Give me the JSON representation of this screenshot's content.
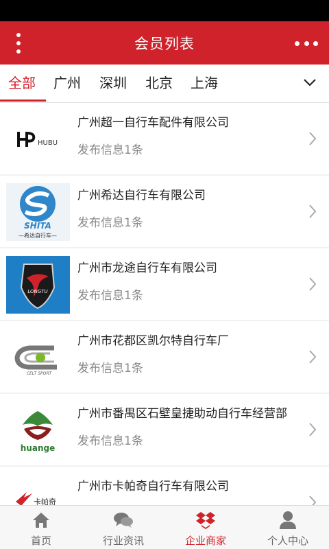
{
  "header": {
    "title": "会员列表"
  },
  "tabs": [
    {
      "label": "全部",
      "active": true
    },
    {
      "label": "广州",
      "active": false
    },
    {
      "label": "深圳",
      "active": false
    },
    {
      "label": "北京",
      "active": false
    },
    {
      "label": "上海",
      "active": false
    }
  ],
  "companies": [
    {
      "name": "广州超一自行车配件有限公司",
      "info": "发布信息1条",
      "logo_text": "HUBU"
    },
    {
      "name": "广州希达自行车有限公司",
      "info": "发布信息1条",
      "logo_text": "SHITA",
      "logo_sub": "—希达自行车—"
    },
    {
      "name": "广州市龙途自行车有限公司",
      "info": "发布信息1条",
      "logo_text": "LONGTU"
    },
    {
      "name": "广州市花都区凯尔特自行车厂",
      "info": "发布信息1条",
      "logo_text": "CELT SPORT"
    },
    {
      "name": "广州市番禺区石壁皇捷助动自行车经营部",
      "info": "发布信息1条",
      "logo_text": "huange"
    },
    {
      "name": "广州市卡帕奇自行车有限公司",
      "info": "",
      "logo_text": "卡帕奇"
    }
  ],
  "bottom_nav": [
    {
      "label": "首页",
      "icon": "home-icon",
      "active": false
    },
    {
      "label": "行业资讯",
      "icon": "chat-bubbles-icon",
      "active": false
    },
    {
      "label": "企业商家",
      "icon": "dropbox-icon",
      "active": true
    },
    {
      "label": "个人中心",
      "icon": "person-icon",
      "active": false
    }
  ],
  "colors": {
    "brand": "#d0222b",
    "muted": "#888888"
  }
}
